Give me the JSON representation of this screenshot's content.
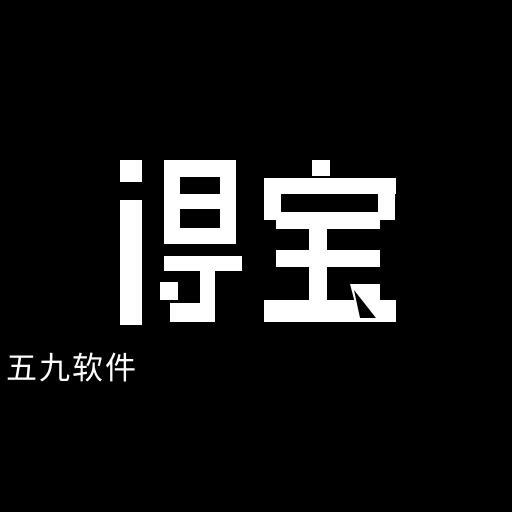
{
  "logo": {
    "wordmark": "得宝",
    "color": "#ffffff"
  },
  "brand_name": "五九软件",
  "colors": {
    "background": "#000000",
    "foreground": "#ffffff"
  }
}
